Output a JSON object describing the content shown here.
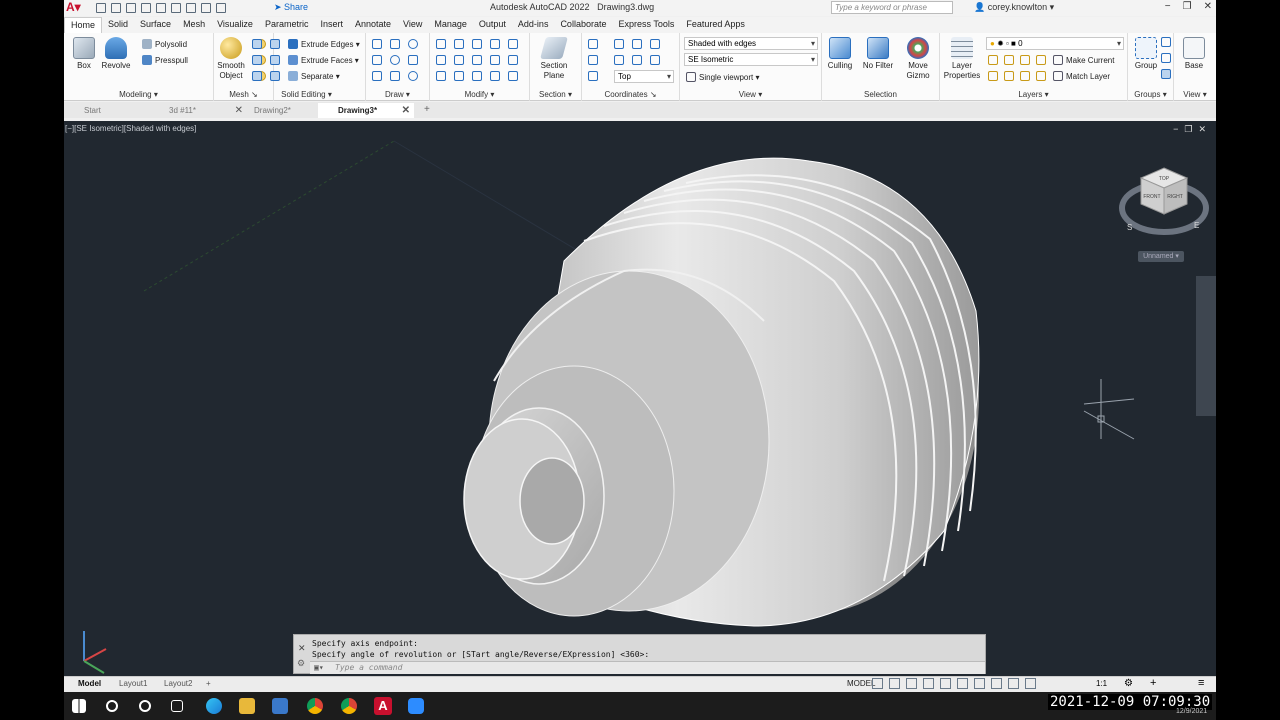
{
  "app": {
    "window_title": "Autodesk AutoCAD 2022",
    "file": "Drawing3.dwg",
    "share": "Share",
    "search_placeholder": "Type a keyword or phrase",
    "user": "corey.knowlton"
  },
  "ribbon_tabs": [
    "Home",
    "Solid",
    "Surface",
    "Mesh",
    "Visualize",
    "Parametric",
    "Insert",
    "Annotate",
    "View",
    "Manage",
    "Output",
    "Add-ins",
    "Collaborate",
    "Express Tools",
    "Featured Apps"
  ],
  "ribbon": {
    "modeling": {
      "title": "Modeling",
      "box": "Box",
      "revolve": "Revolve",
      "polysolid": "Polysolid",
      "presspull": "Presspull"
    },
    "mesh": {
      "title": "Mesh",
      "smooth1": "Smooth",
      "smooth2": "Object"
    },
    "solid_editing": {
      "title": "Solid Editing",
      "extrude_edges": "Extrude Edges",
      "extrude_faces": "Extrude Faces",
      "separate": "Separate"
    },
    "draw": {
      "title": "Draw"
    },
    "modify": {
      "title": "Modify"
    },
    "section": {
      "title": "Section",
      "plane1": "Section",
      "plane2": "Plane"
    },
    "coordinates": {
      "title": "Coordinates",
      "top": "Top"
    },
    "view": {
      "title": "View",
      "visual_style": "Shaded with edges",
      "view_name": "SE Isometric",
      "viewport": "Single viewport"
    },
    "selection": {
      "title": "Selection",
      "culling": "Culling",
      "no_filter": "No Filter",
      "move_gizmo1": "Move",
      "move_gizmo2": "Gizmo"
    },
    "layers": {
      "title": "Layers",
      "layer_props1": "Layer",
      "layer_props2": "Properties",
      "layer_value": "0",
      "make_current": "Make Current",
      "match_layer": "Match Layer"
    },
    "groups": {
      "title": "Groups",
      "group": "Group"
    },
    "viewpanel": {
      "title": "View",
      "base": "Base"
    }
  },
  "doc_tabs": [
    {
      "label": "Start"
    },
    {
      "label": "3d #11*"
    },
    {
      "label": "Drawing2*"
    },
    {
      "label": "Drawing3*"
    }
  ],
  "viewport": {
    "label": "[−][SE Isometric][Shaded with edges]",
    "unnamed": "Unnamed",
    "viewcube": {
      "top": "TOP",
      "front": "FRONT",
      "right": "RIGHT",
      "s": "S",
      "e": "E"
    }
  },
  "command": {
    "history": [
      "Specify axis endpoint:",
      "Specify angle of revolution or [STart angle/Reverse/EXpression] <360>:"
    ],
    "placeholder": "Type a command"
  },
  "status": {
    "layout_tabs": [
      "Model",
      "Layout1",
      "Layout2"
    ],
    "model": "MODEL",
    "scale": "1:1"
  },
  "clock": {
    "time": "2021-12-09 07:09:30",
    "small_date": "12/9/2021"
  },
  "colors": {
    "viewport_bg": "#212830",
    "brand": "#c8102e",
    "accent": "#0a64c8"
  }
}
